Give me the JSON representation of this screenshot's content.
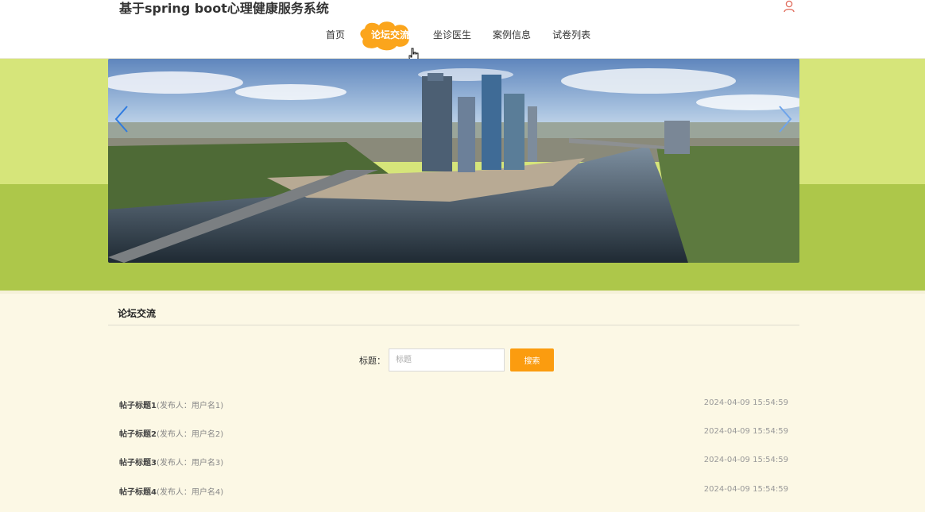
{
  "header": {
    "site_title": "基于spring boot心理健康服务系统",
    "user_icon": "user-icon"
  },
  "nav": {
    "items": [
      {
        "label": "首页"
      },
      {
        "label": "论坛交流",
        "active": true
      },
      {
        "label": "坐诊医生"
      },
      {
        "label": "案例信息"
      },
      {
        "label": "试卷列表"
      }
    ]
  },
  "banner": {
    "prev_icon": "chevron-left-icon",
    "next_icon": "chevron-right-icon"
  },
  "section": {
    "title": "论坛交流"
  },
  "search": {
    "label": "标题：",
    "placeholder": "标题",
    "button_label": "搜索"
  },
  "posts": [
    {
      "title": "帖子标题1",
      "meta": "(发布人：用户名1)",
      "time": "2024-04-09 15:54:59"
    },
    {
      "title": "帖子标题2",
      "meta": "(发布人：用户名2)",
      "time": "2024-04-09 15:54:59"
    },
    {
      "title": "帖子标题3",
      "meta": "(发布人：用户名3)",
      "time": "2024-04-09 15:54:59"
    },
    {
      "title": "帖子标题4",
      "meta": "(发布人：用户名4)",
      "time": "2024-04-09 15:54:59"
    }
  ],
  "colors": {
    "accent": "#fb9c0f",
    "band_light": "#d6e57a",
    "band_dark": "#adc74a",
    "page_bg": "#fcf8e5"
  }
}
